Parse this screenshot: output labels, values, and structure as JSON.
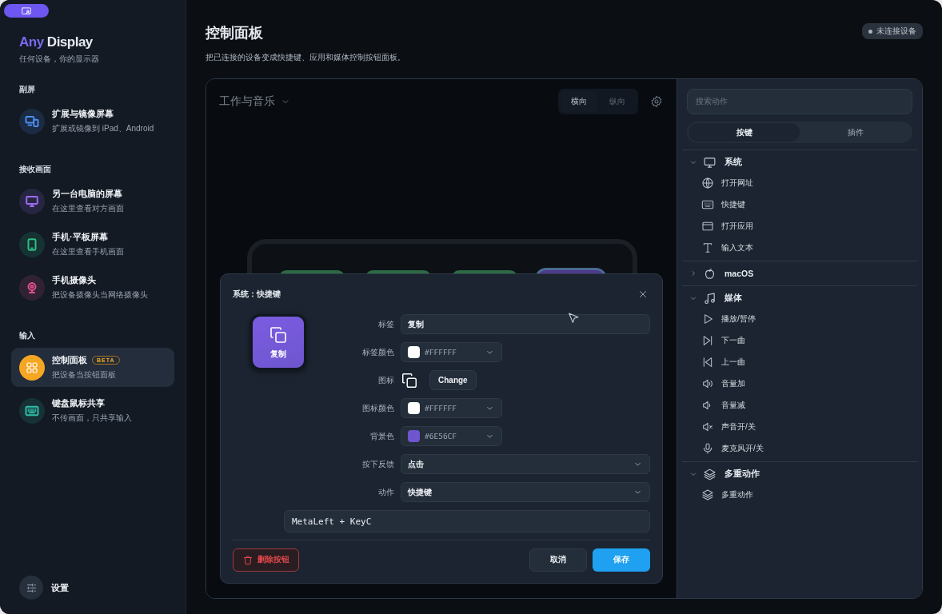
{
  "sidebar": {
    "brand": {
      "accent": "Any",
      "rest": "Display"
    },
    "tagline": "任何设备，你的显示器",
    "sections": [
      {
        "heading": "副屏",
        "items": [
          {
            "title": "扩展与镜像屏幕",
            "subtitle": "扩展或镜像到 iPad、Android",
            "color": "#4a8df0",
            "selected": false
          }
        ]
      },
      {
        "heading": "接收画面",
        "items": [
          {
            "title": "另一台电脑的屏幕",
            "subtitle": "在这里查看对方画面",
            "color": "#9b6cf0",
            "selected": false
          },
          {
            "title": "手机·平板屏幕",
            "subtitle": "在这里查看手机画面",
            "color": "#2fbf83",
            "selected": false
          },
          {
            "title": "手机摄像头",
            "subtitle": "把设备摄像头当网络摄像头",
            "color": "#e0508a",
            "selected": false
          }
        ]
      },
      {
        "heading": "输入",
        "items": [
          {
            "title": "控制面板",
            "subtitle": "把设备当按钮面板",
            "color": "#f5a623",
            "selected": true,
            "badge": "BETA"
          },
          {
            "title": "键盘鼠标共享",
            "subtitle": "不传画面，只共享输入",
            "color": "#2fbfa8",
            "selected": false
          }
        ]
      }
    ],
    "settings": "设置"
  },
  "header": {
    "title": "控制面板",
    "subtitle": "把已连接的设备变成快捷键、应用和媒体控制按钮面板。",
    "status": "未连接设备"
  },
  "canvas": {
    "layout_name": "工作与音乐",
    "orientation_tabs": [
      {
        "label": "横向",
        "selected": true
      },
      {
        "label": "纵向",
        "selected": false
      }
    ],
    "keys": [
      {
        "color": "#2d6a44",
        "selected": false
      },
      {
        "color": "#2d6a44",
        "selected": false
      },
      {
        "color": "#2d6a44",
        "selected": false
      },
      {
        "color": "#4e3a8c",
        "selected": true
      }
    ]
  },
  "dialog": {
    "title": "系统：快捷键",
    "preview": {
      "label": "复制",
      "color": "#7b5ce0"
    },
    "fields": [
      {
        "kind": "text",
        "label": "标签",
        "value": "复制"
      },
      {
        "kind": "color",
        "label": "标签颜色",
        "value": "#FFFFFF",
        "color": "#ffffff"
      },
      {
        "kind": "icon",
        "label": "图标",
        "button": "Change"
      },
      {
        "kind": "color",
        "label": "图标颜色",
        "value": "#FFFFFF",
        "color": "#ffffff"
      },
      {
        "kind": "color",
        "label": "背景色",
        "value": "#6E56CF",
        "color": "#6e56cf"
      },
      {
        "kind": "select",
        "label": "按下反馈",
        "value": "点击"
      },
      {
        "kind": "select",
        "label": "动作",
        "value": "快捷键"
      },
      {
        "kind": "code",
        "value": "MetaLeft + KeyC"
      }
    ],
    "delete_button": "删除按钮",
    "cancel_button": "取消",
    "save_button": "保存"
  },
  "actions": {
    "search_placeholder": "搜索动作",
    "tabs": [
      {
        "label": "按键",
        "selected": true
      },
      {
        "label": "插件",
        "selected": false
      }
    ],
    "groups": [
      {
        "name": "系统",
        "expanded": true,
        "children": [
          {
            "name": "打开网址"
          },
          {
            "name": "快捷键"
          },
          {
            "name": "打开应用"
          },
          {
            "name": "输入文本"
          }
        ]
      },
      {
        "name": "macOS",
        "expanded": false
      },
      {
        "name": "媒体",
        "expanded": true,
        "children": [
          {
            "name": "播放/暂停"
          },
          {
            "name": "下一曲"
          },
          {
            "name": "上一曲"
          },
          {
            "name": "音量加"
          },
          {
            "name": "音量减"
          },
          {
            "name": "声音开/关"
          },
          {
            "name": "麦克风开/关"
          }
        ]
      },
      {
        "name": "多重动作",
        "expanded": true,
        "children": [
          {
            "name": "多重动作"
          }
        ]
      }
    ]
  }
}
